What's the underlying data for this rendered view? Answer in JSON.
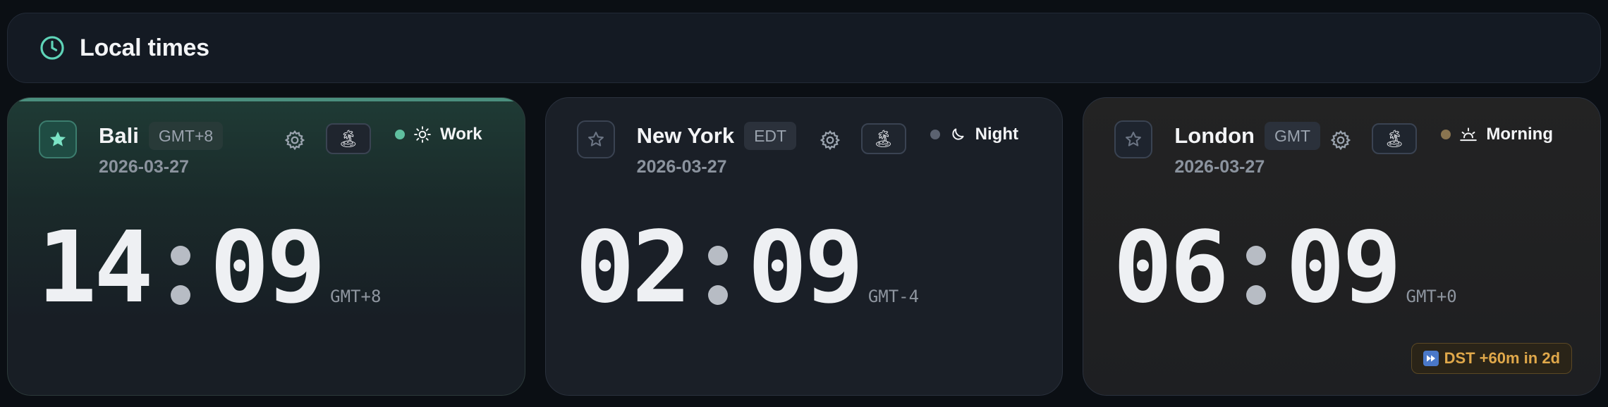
{
  "header": {
    "title": "Local times",
    "icon": "clock-icon",
    "accent": "#5fd4b8"
  },
  "cards": [
    {
      "city": "Bali",
      "tz_label": "GMT+8",
      "date": "2026-03-27",
      "hours": "14",
      "minutes": "09",
      "offset": "GMT+8",
      "status": {
        "label": "Work",
        "icon": "sun-icon",
        "dot_color": "#5fbf9f"
      },
      "starred": true
    },
    {
      "city": "New York",
      "tz_label": "EDT",
      "date": "2026-03-27",
      "hours": "02",
      "minutes": "09",
      "offset": "GMT-4",
      "status": {
        "label": "Night",
        "icon": "moon-icon",
        "dot_color": "#5b6270"
      },
      "starred": false
    },
    {
      "city": "London",
      "tz_label": "GMT",
      "date": "2026-03-27",
      "hours": "06",
      "minutes": "09",
      "offset": "GMT+0",
      "status": {
        "label": "Morning",
        "icon": "sunrise-icon",
        "dot_color": "#8a7550"
      },
      "starred": false,
      "dst_badge": "DST +60m in 2d"
    }
  ],
  "vacation_icon": "🏝",
  "dst_color": "#e0a84a"
}
